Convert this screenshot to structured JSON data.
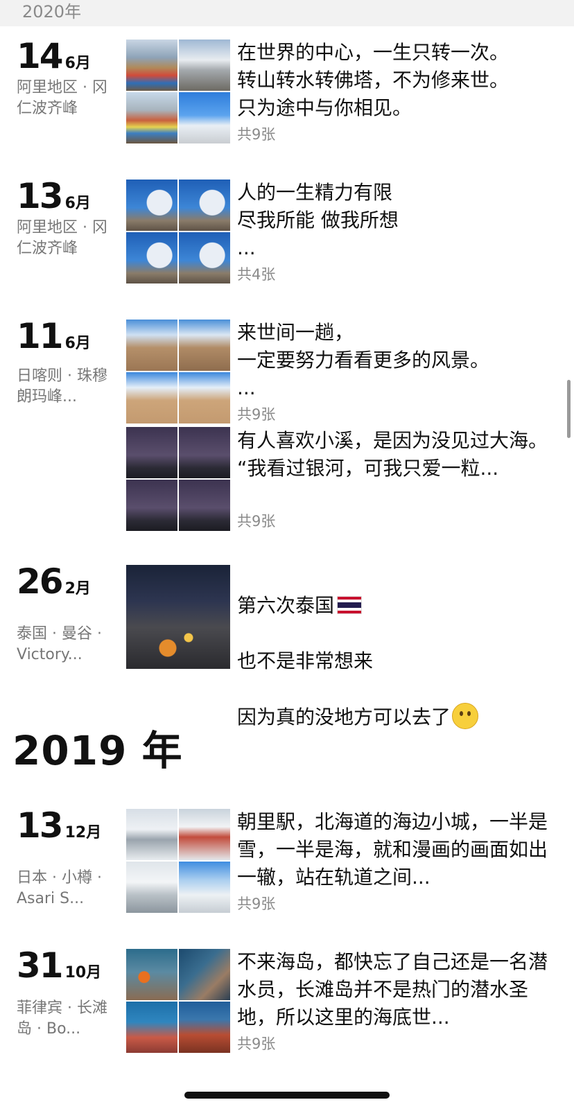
{
  "sticky_year": "2020年",
  "year_heading_2019": "2019 年",
  "entries": [
    {
      "day": "14",
      "month": "6月",
      "location": "阿里地区 · 冈仁波齐峰",
      "caption": "在世界的中心，一生只转一次。\n转山转水转佛塔，不为修来世。\n只为途中与你相见。",
      "count": "共9张",
      "thumbs": [
        "prayer-flags-snow",
        "prayer-flags-rocks",
        "prayer-flags-valley",
        "hikers-blue-sky"
      ]
    },
    {
      "day": "13",
      "month": "6月",
      "location": "阿里地区 · 冈仁波齐峰",
      "caption": "人的一生精力有限\n尽我所能 做我所想\n...",
      "count": "共4张",
      "thumbs": [
        "hiker-snow-peak",
        "hiker-snow-peak",
        "hiker-snow-peak",
        "hiker-snow-peak"
      ]
    },
    {
      "day": "11",
      "month": "6月",
      "location": "日喀则 · 珠穆朗玛峰...",
      "caption": "来世间一趟，\n一定要努力看看更多的风景。\n...",
      "count": "共9张",
      "thumbs": [
        "desert-hills",
        "desert-hills",
        "desert-road",
        "desert-road"
      ]
    },
    {
      "caption": "有人喜欢小溪，是因为没见过大海。\n“我看过银河，可我只爱一粒...",
      "count": "共9张",
      "thumbs": [
        "night-sky-mountain",
        "night-sky-mountain",
        "night-sky-mountain",
        "night-sky-mountain"
      ]
    },
    {
      "day": "26",
      "month": "2月",
      "location": "泰国 · 曼谷 · Victory...",
      "caption_line1": "第六次泰国",
      "caption_line2": "也不是非常想来",
      "caption_line3": "因为真的没地方可以去了",
      "thumbs": [
        "bangkok-street-night"
      ]
    },
    {
      "day": "13",
      "month": "12月",
      "location": "日本 · 小樽 · Asari S...",
      "caption": "朝里駅，北海道的海边小城，一半是雪，一半是海，就和漫画的画面如出一辙，站在轨道之间...",
      "count": "共9张",
      "thumbs": [
        "snow-station",
        "snow-train",
        "snow-town",
        "snow-street"
      ]
    },
    {
      "day": "31",
      "month": "10月",
      "location": "菲律宾 · 长滩岛 · Bo...",
      "caption": "不来海岛，都快忘了自己还是一名潜水员，长滩岛并不是热门的潜水圣地，所以这里的海底世...",
      "count": "共9张",
      "thumbs": [
        "clownfish-reef",
        "lionfish",
        "coral-reef",
        "coral-reef-2"
      ]
    }
  ],
  "colors": {
    "sticky_bg": "#f2f2f2",
    "secondary_text": "#8a8a8a",
    "location_text": "#777777",
    "primary_text": "#111111"
  }
}
